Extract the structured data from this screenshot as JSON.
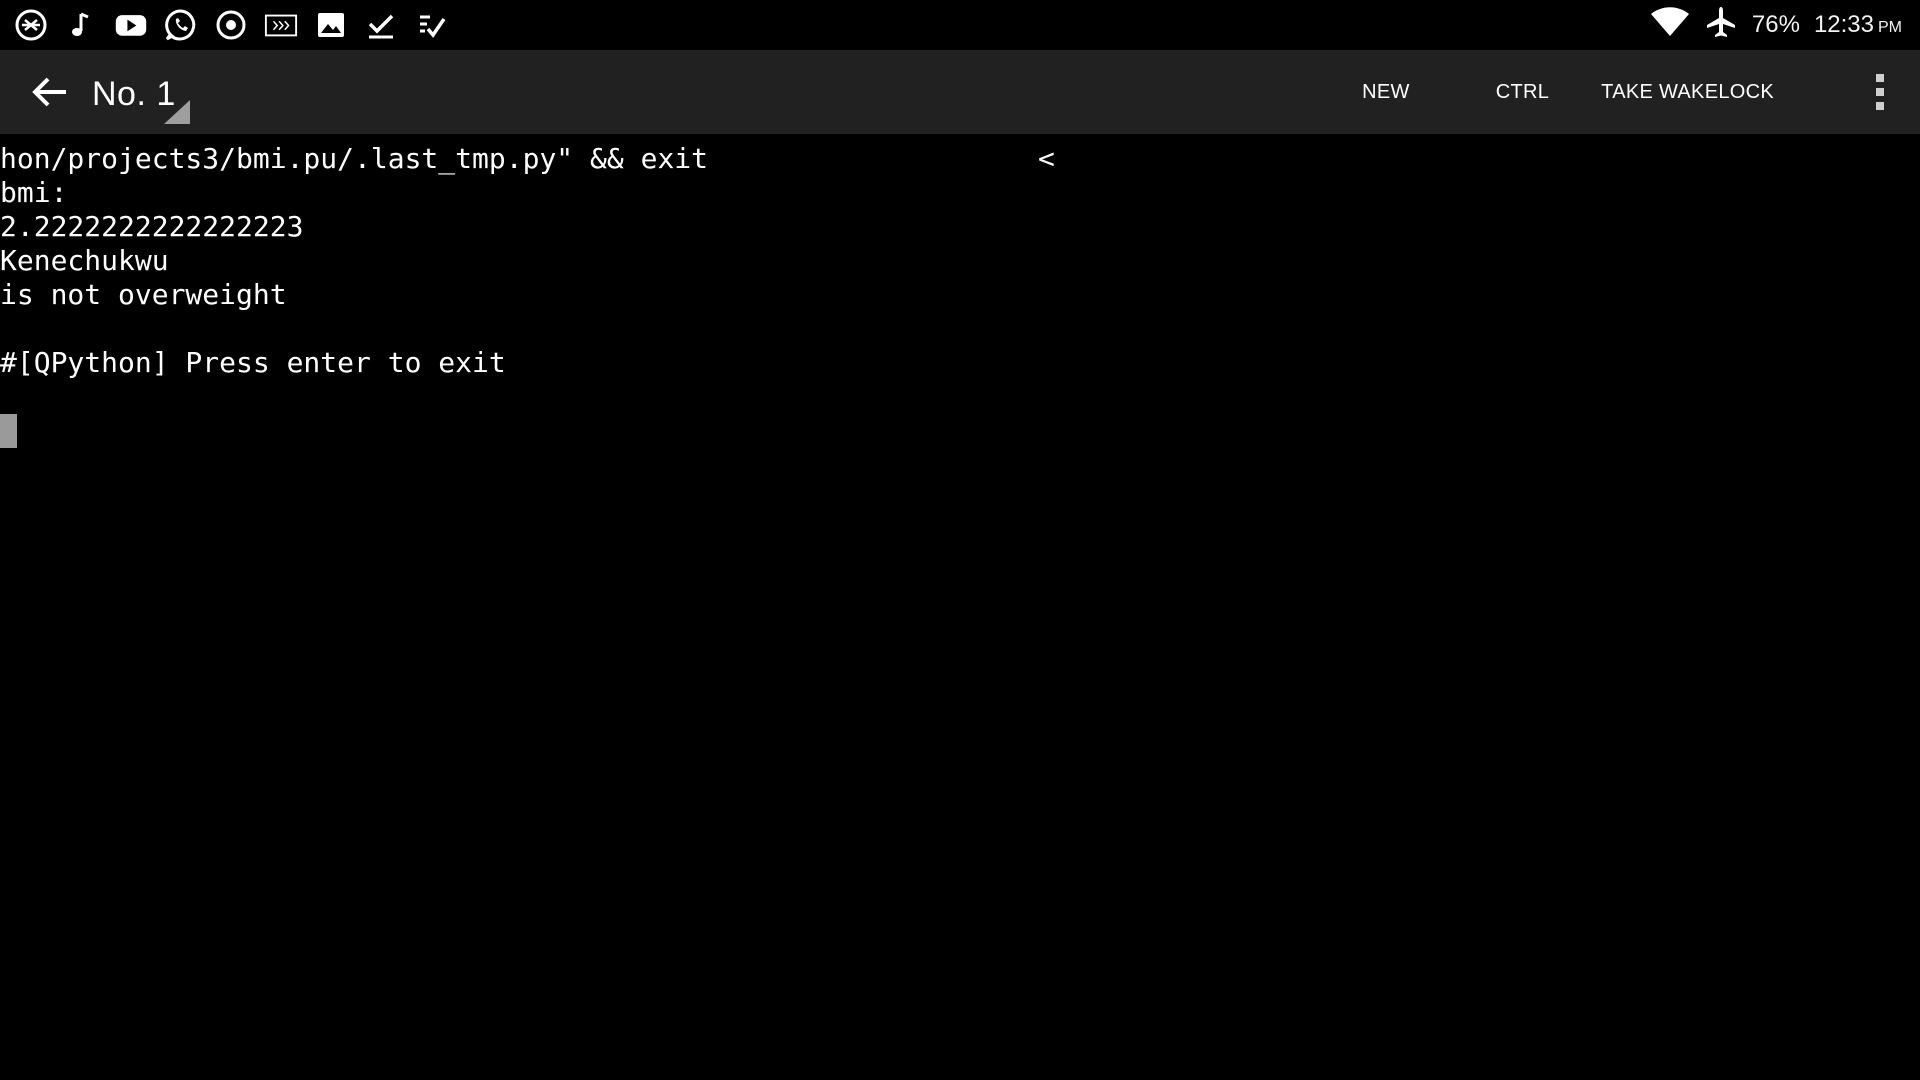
{
  "status_bar": {
    "left_icons": [
      "abx-app-icon",
      "music-note-icon",
      "youtube-icon",
      "whatsapp-icon",
      "record-icon",
      "terminal-arrows-icon",
      "image-icon",
      "checkmark-icon",
      "checklist-icon"
    ],
    "wifi_icon": "wifi-icon",
    "airplane_icon": "airplane-icon",
    "battery": "76%",
    "time": "12:33",
    "ampm": "PM"
  },
  "action_bar": {
    "back_icon": "back-arrow-icon",
    "session_title": "No. 1",
    "new_label": "NEW",
    "ctrl_label": "CTRL",
    "wakelock_label": "TAKE WAKELOCK",
    "overflow_icon": "overflow-menu-icon"
  },
  "terminal": {
    "lines": [
      "hon/projects3/bmi.pu/.last_tmp.py\" && exit",
      "bmi:",
      "2.2222222222222223",
      "Kenechukwu",
      "is not overweight",
      "",
      "#[QPython] Press enter to exit",
      ""
    ],
    "scroll_marker": "<"
  },
  "colors": {
    "background": "#000000",
    "action_bar": "#212121",
    "text": "#ffffff",
    "cursor": "#9a9a9a"
  }
}
